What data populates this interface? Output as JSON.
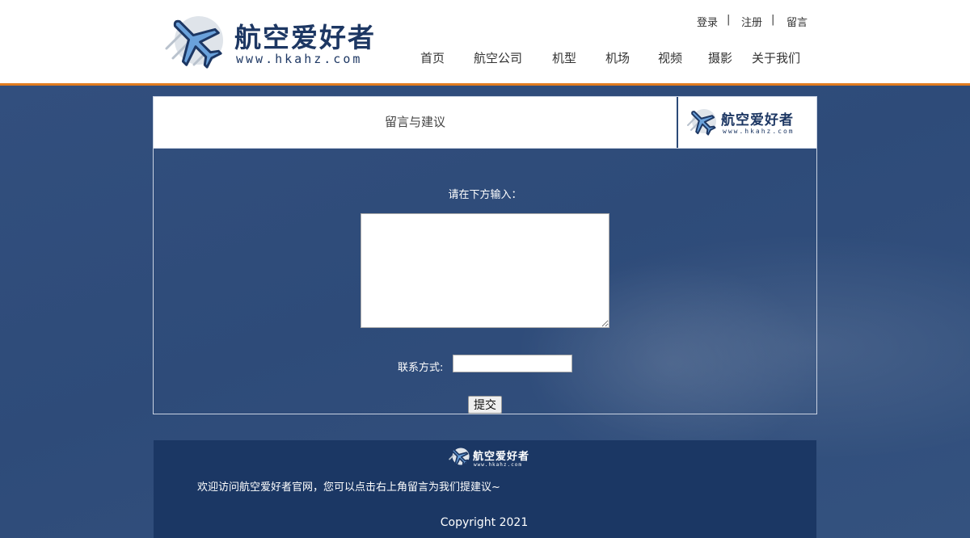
{
  "brand": {
    "name_cn": "航空爱好者",
    "url": "www.hkahz.com"
  },
  "top_links": [
    "登录",
    "|",
    "注册",
    "|",
    "留言"
  ],
  "nav": [
    "首页",
    "航空公司",
    "机型",
    "机场",
    "视频",
    "摄影",
    "关于我们"
  ],
  "panel": {
    "title": "留言与建议",
    "prompt": "请在下方输入：",
    "message_value": "",
    "contact_label": "联系方式:",
    "contact_value": "",
    "submit_label": "提交"
  },
  "footer": {
    "welcome": "欢迎访问航空爱好者官网，您可以点击右上角留言为我们提建议~",
    "copyright": "Copyright 2021"
  },
  "colors": {
    "accent": "#e07b1f",
    "brand": "#1d3763",
    "footer_bg": "#1b3764",
    "page_bg": "#2f4d7c"
  }
}
